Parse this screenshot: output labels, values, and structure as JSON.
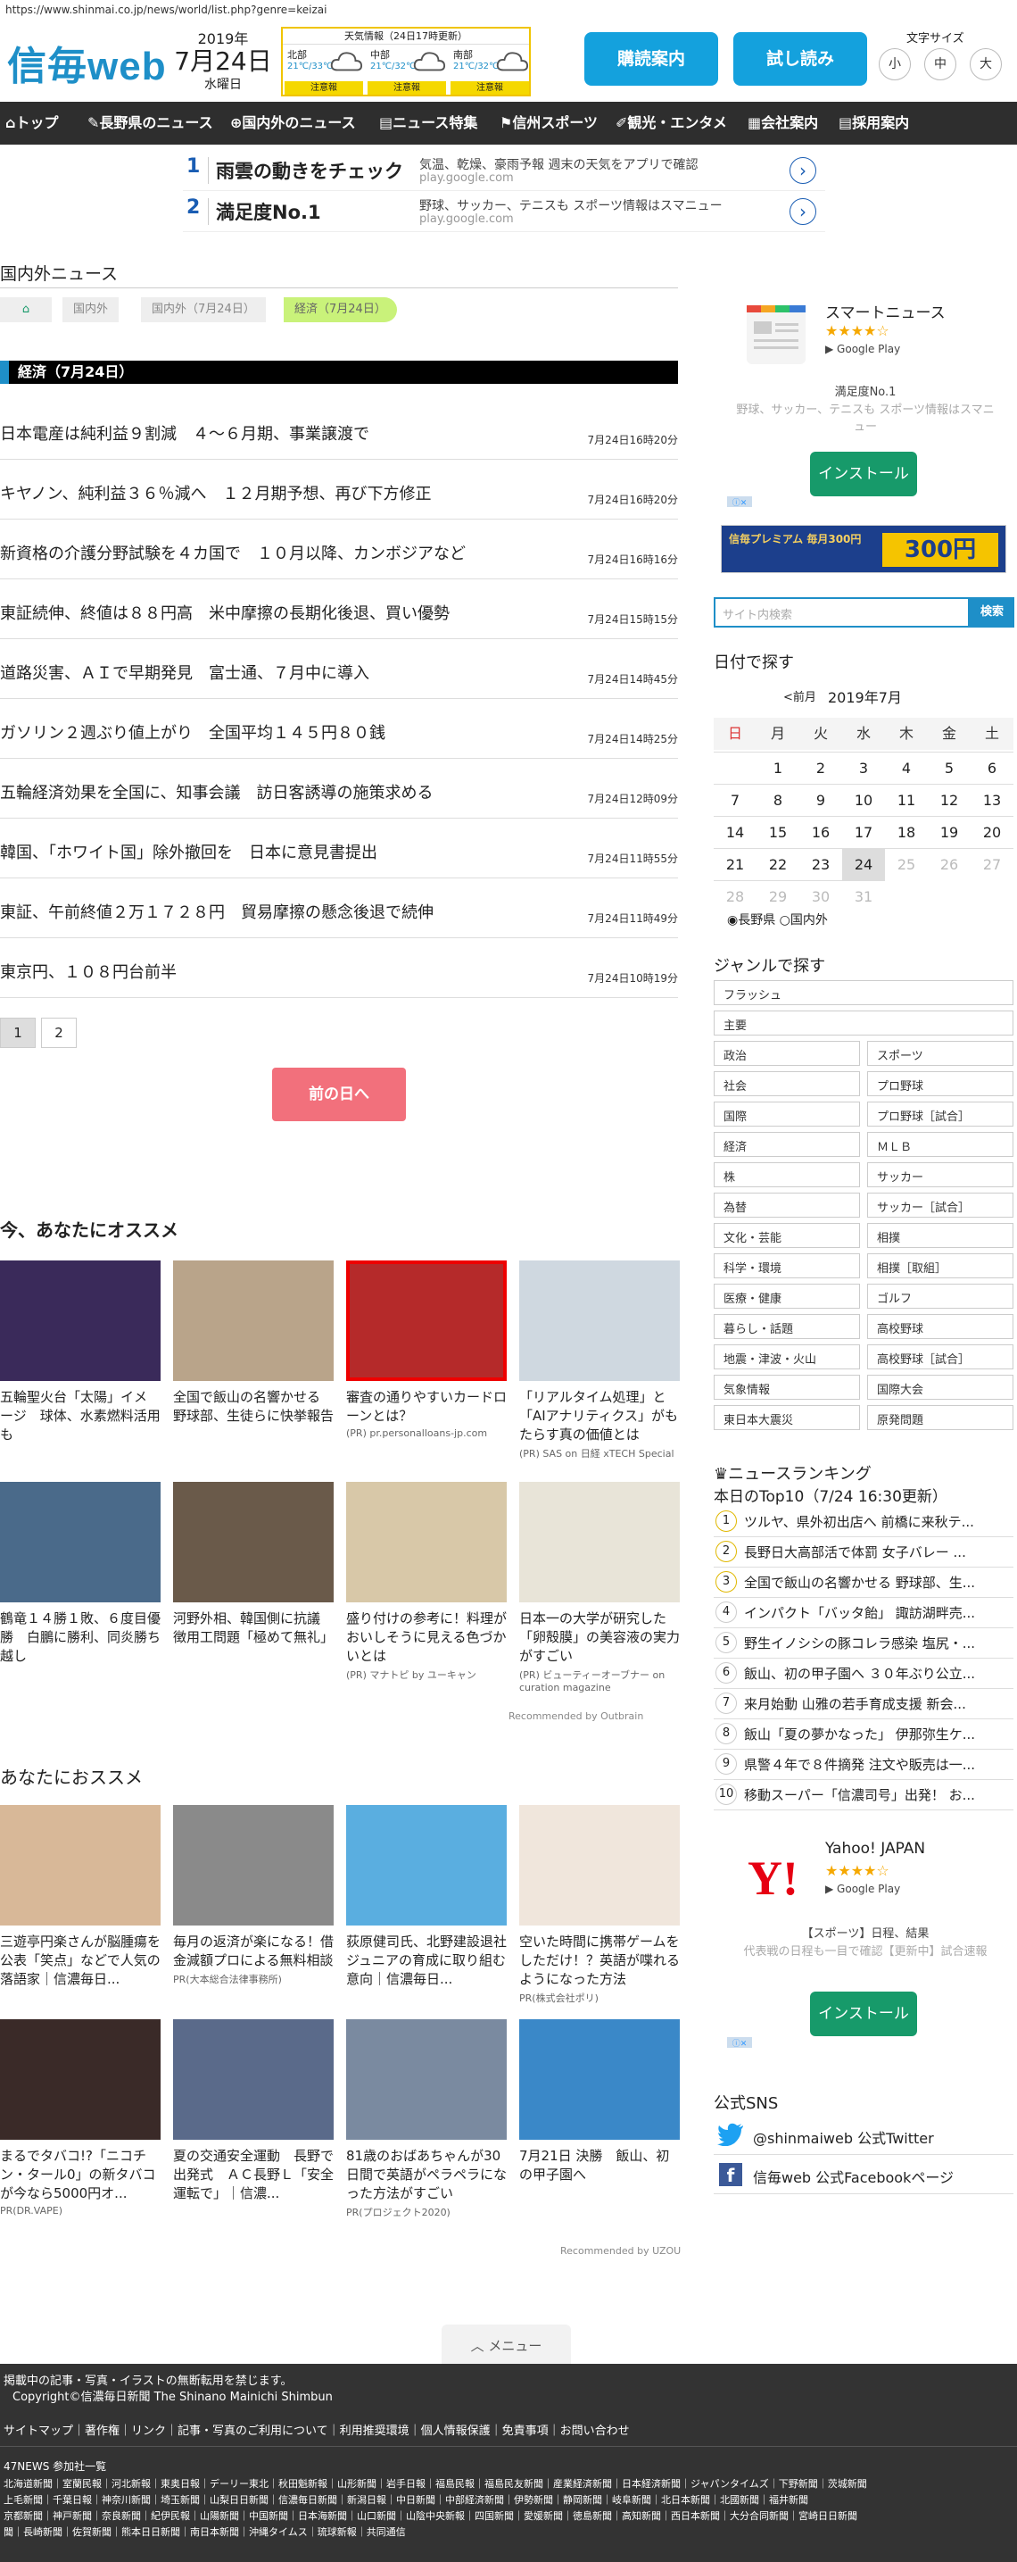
{
  "url": "https://www.shinmai.co.jp/news/world/list.php?genre=keizai",
  "header": {
    "logo": "信毎web",
    "date": {
      "year": "2019年",
      "day": "7月24日",
      "weekday": "水曜日"
    },
    "weather": {
      "title": "天気情報（24日17時更新）",
      "regions": [
        {
          "name": "北部",
          "temp": "21℃/33℃",
          "warn": "注意報"
        },
        {
          "name": "中部",
          "temp": "21℃/32℃",
          "warn": "注意報"
        },
        {
          "name": "南部",
          "temp": "21℃/32℃",
          "warn": "注意報"
        }
      ]
    },
    "subscribe_label": "購読案内",
    "trial_label": "試し読み",
    "font_size_label": "文字サイズ",
    "font_sizes": [
      "小",
      "中",
      "大"
    ]
  },
  "nav": [
    {
      "icon": "home-icon",
      "label": "トップ"
    },
    {
      "icon": "pin-icon",
      "label": "長野県のニュース"
    },
    {
      "icon": "globe-icon",
      "label": "国内外のニュース"
    },
    {
      "icon": "document-icon",
      "label": "ニュース特集"
    },
    {
      "icon": "sports-icon",
      "label": "信州スポーツ"
    },
    {
      "icon": "pencil-icon",
      "label": "観光・エンタメ"
    },
    {
      "icon": "building-icon",
      "label": "会社案内"
    },
    {
      "icon": "list-icon",
      "label": "採用案内"
    }
  ],
  "ads": [
    {
      "n": "1",
      "title": "雨雲の動きをチェック",
      "text": "気温、乾燥、豪雨予報 週末の天気をアプリで確認",
      "url": "play.google.com"
    },
    {
      "n": "2",
      "title": "満足度No.1",
      "text": "野球、サッカー、テニスも スポーツ情報はスマニュー",
      "url": "play.google.com"
    }
  ],
  "section_title": "国内外ニュース",
  "breadcrumb": [
    "国内外",
    "国内外（7月24日）",
    "経済（7月24日）"
  ],
  "genre_bar": "経済（7月24日）",
  "news": [
    {
      "title": "日本電産は純利益９割減　４～６月期、事業譲渡で",
      "time": "7月24日16時20分"
    },
    {
      "title": "キヤノン、純利益３６％減へ　１２月期予想、再び下方修正",
      "time": "7月24日16時20分"
    },
    {
      "title": "新資格の介護分野試験を４カ国で　１０月以降、カンボジアなど",
      "time": "7月24日16時16分"
    },
    {
      "title": "東証続伸、終値は８８円高　米中摩擦の長期化後退、買い優勢",
      "time": "7月24日15時15分"
    },
    {
      "title": "道路災害、ＡＩで早期発見　富士通、７月中に導入",
      "time": "7月24日14時45分"
    },
    {
      "title": "ガソリン２週ぶり値上がり　全国平均１４５円８０銭",
      "time": "7月24日14時25分"
    },
    {
      "title": "五輪経済効果を全国に、知事会議　訪日客誘導の施策求める",
      "time": "7月24日12時09分"
    },
    {
      "title": "韓国、「ホワイト国」除外撤回を　日本に意見書提出",
      "time": "7月24日11時55分"
    },
    {
      "title": "東証、午前終値２万１７２８円　貿易摩擦の懸念後退で続伸",
      "time": "7月24日11時49分"
    },
    {
      "title": "東京円、１０８円台前半",
      "time": "7月24日10時19分"
    }
  ],
  "pager": [
    "1",
    "2"
  ],
  "prev_day_label": "前の日へ",
  "recommend_title": "今、あなたにオススメ",
  "recommend": [
    {
      "cap": "五輪聖火台「太陽」イメージ　球体、水素燃料活用も",
      "pr": ""
    },
    {
      "cap": "全国で飯山の名響かせる　野球部、生徒らに快挙報告",
      "pr": ""
    },
    {
      "cap": "審査の通りやすいカードローンとは？",
      "pr": "(PR) pr.personalloans-jp.com"
    },
    {
      "cap": "「リアルタイム処理」と「AIアナリティクス」がもたらす真の価値とは",
      "pr": "(PR) SAS on 日経 xTECH Special"
    },
    {
      "cap": "鶴竜１４勝１敗、６度目優勝　白鵬に勝利、同炎勝ち越し",
      "pr": ""
    },
    {
      "cap": "河野外相、韓国側に抗議　徴用工問題「極めて無礼」",
      "pr": ""
    },
    {
      "cap": "盛り付けの参考に！料理がおいしそうに見える色づかいとは",
      "pr": "(PR) マナトピ by ユーキャン"
    },
    {
      "cap": "日本一の大学が研究した「卵殻膜」の美容液の実力がすごい",
      "pr": "(PR) ビューティーオーブナー on curation magazine"
    }
  ],
  "outbrain_label": "Recommended by Outbrain",
  "osusume_title": "あなたにおススメ",
  "osusume": [
    {
      "cap": "三遊亭円楽さんが脳腫瘍を公表「笑点」などで人気の落語家｜信濃毎日...",
      "pr": ""
    },
    {
      "cap": "毎月の返済が楽になる！借金減額プロによる無料相談",
      "pr": "PR(大本総合法律事務所)"
    },
    {
      "cap": "荻原健司氏、北野建設退社　ジュニアの育成に取り組む意向｜信濃毎日...",
      "pr": ""
    },
    {
      "cap": "空いた時間に携帯ゲームをしただけ！？英語が喋れるようになった方法",
      "pr": "PR(株式会社ポリ)"
    },
    {
      "cap": "まるでタバコ!?「ニコチン・タール0」の新タバコが今なら5000円オ...",
      "pr": "PR(DR.VAPE)"
    },
    {
      "cap": "夏の交通安全運動　長野で出発式　ＡＣ長野Ｌ「安全運転で」｜信濃...",
      "pr": ""
    },
    {
      "cap": "81歳のおばあちゃんが30日間で英語がペラペラになった方法がすごい",
      "pr": "PR(プロジェクト2020)"
    },
    {
      "cap": "7月21日 決勝　飯山、初の甲子園へ",
      "pr": ""
    }
  ],
  "uzou_label": "Recommended by UZOU",
  "side": {
    "smartnews": {
      "title": "スマートニュース",
      "stars": "★★★★☆",
      "store": "Google Play",
      "tag": "満足度No.1",
      "text": "野球、サッカー、テニスも スポーツ情報はスマニュー",
      "install": "インストール"
    },
    "premium_banner": "信毎プレミアム 毎月300円",
    "search_placeholder": "サイト内検索",
    "search_button": "検索",
    "date_title": "日付で探す",
    "calendar": {
      "prev": "<前月",
      "month": "2019年7月",
      "weekdays": [
        "日",
        "月",
        "火",
        "水",
        "木",
        "金",
        "土"
      ],
      "days": [
        "",
        "1",
        "2",
        "3",
        "4",
        "5",
        "6",
        "7",
        "8",
        "9",
        "10",
        "11",
        "12",
        "13",
        "14",
        "15",
        "16",
        "17",
        "18",
        "19",
        "20",
        "21",
        "22",
        "23",
        "24",
        "25",
        "26",
        "27",
        "28",
        "29",
        "30",
        "31"
      ],
      "radio": [
        "長野県",
        "国内外"
      ]
    },
    "genre_title": "ジャンルで探す",
    "genres_full": [
      "フラッシュ",
      "主要"
    ],
    "genres": [
      "政治",
      "スポーツ",
      "社会",
      "プロ野球",
      "国際",
      "プロ野球［試合］",
      "経済",
      "ＭＬＢ",
      "株",
      "サッカー",
      "為替",
      "サッカー［試合］",
      "文化・芸能",
      "相撲",
      "科学・環境",
      "相撲［取組］",
      "医療・健康",
      "ゴルフ",
      "暮らし・話題",
      "高校野球",
      "地震・津波・火山",
      "高校野球［試合］",
      "気象情報",
      "国際大会",
      "東日本大震災",
      "原発問題"
    ],
    "ranking_title": "ニュースランキング",
    "ranking_sub": "本日のTop10（7/24 16:30更新）",
    "ranking": [
      "ツルヤ、県外初出店へ 前橋に来秋テ...",
      "長野日大高部活で体罰 女子バレー ...",
      "全国で飯山の名響かせる 野球部、生...",
      "インパクト「バッタ飴」 諏訪湖畔売...",
      "野生イノシシの豚コレラ感染 塩尻・...",
      "飯山、初の甲子園へ ３０年ぶり公立...",
      "来月始動 山雅の若手育成支援 新会...",
      "飯山「夏の夢かなった」 伊那弥生ケ...",
      "県警４年で８件摘発 注文や販売は一...",
      "移動スーパー「信濃司号」出発！ お..."
    ],
    "yahoo": {
      "title": "Yahoo! JAPAN",
      "stars": "★★★★☆",
      "store": "Google Play",
      "tag": "【スポーツ】日程、結果",
      "text": "代表戦の日程も一目で確認【更新中】試合速報",
      "install": "インストール"
    },
    "sns_title": "公式SNS",
    "sns": [
      "@shinmaiweb 公式Twitter",
      "信毎web 公式Facebookページ"
    ]
  },
  "menu_label": "メニュー",
  "footer": {
    "notice": "掲載中の記事・写真・イラストの無断転用を禁じます。",
    "copyright": "Copyright©信濃毎日新聞 The Shinano Mainichi Shimbun",
    "links": "サイトマップ｜著作権｜リンク｜記事・写真のご利用について｜利用推奨環境｜個人情報保護｜免責事項｜お問い合わせ",
    "network_title": "47NEWS 参加社一覧",
    "network1": "北海道新聞｜室蘭民報｜河北新報｜東奥日報｜デーリー東北｜秋田魁新報｜山形新聞｜岩手日報｜福島民報｜福島民友新聞｜産業経済新聞｜日本経済新聞｜ジャパンタイムズ｜下野新聞｜茨城新聞",
    "network2": "上毛新聞｜千葉日報｜神奈川新聞｜埼玉新聞｜山梨日日新聞｜信濃毎日新聞｜新潟日報｜中日新聞｜中部経済新聞｜伊勢新聞｜静岡新聞｜岐阜新聞｜北日本新聞｜北國新聞｜福井新聞",
    "network3": "京都新聞｜神戸新聞｜奈良新聞｜紀伊民報｜山陽新聞｜中国新聞｜日本海新聞｜山口新聞｜山陰中央新報｜四国新聞｜愛媛新聞｜徳島新聞｜高知新聞｜西日本新聞｜大分合同新聞｜宮崎日日新聞",
    "network4": "聞｜長崎新聞｜佐賀新聞｜熊本日日新聞｜南日本新聞｜沖縄タイムス｜琉球新報｜共同通信"
  }
}
